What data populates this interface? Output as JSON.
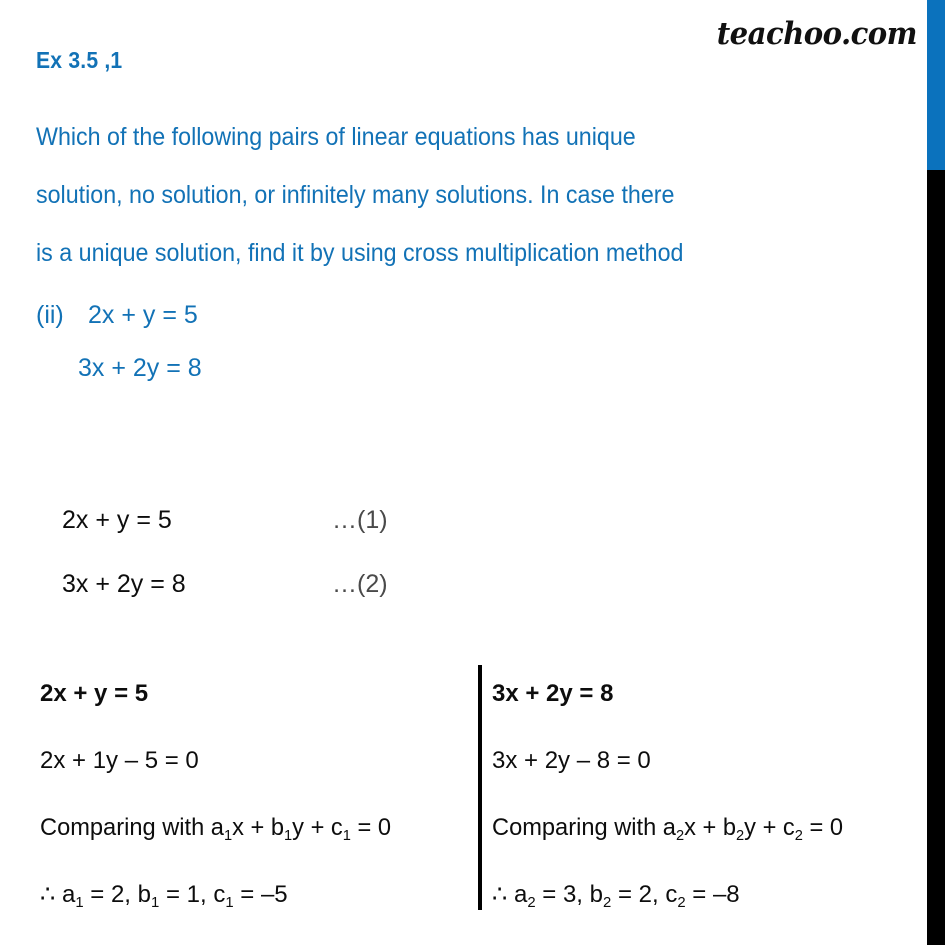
{
  "watermark": {
    "text": "teachoo.com"
  },
  "colors": {
    "accent_blue": "#1272b6",
    "strip_blue": "#0b72bd",
    "strip_black": "#000000",
    "body_black": "#0d0d0d",
    "tag_gray": "#4a4a4a"
  },
  "heading": {
    "text": "Ex 3.5 ,1"
  },
  "question": {
    "lines": [
      "Which of the following pairs of linear equations has unique",
      "solution, no solution, or infinitely many solutions. In case there",
      "is a unique solution, find it by using cross multiplication method"
    ],
    "part": {
      "label": "(ii)",
      "equation_1": "2x + y = 5",
      "equation_2": "3x + 2y = 8"
    }
  },
  "numbered_equations": [
    {
      "equation": "2x + y = 5",
      "tag": "…(1)"
    },
    {
      "equation": "3x + 2y = 8",
      "tag": "…(2)"
    }
  ],
  "compare_table": {
    "left_column": {
      "heading": "2x + y = 5",
      "standard_form": "2x + 1y – 5 = 0",
      "comparing_prefix": "Comparing with a",
      "comparing_sub_1": "1",
      "comparing_mid_1": "x + b",
      "comparing_sub_2": "1",
      "comparing_mid_2": "y + c",
      "comparing_sub_3": "1",
      "comparing_suffix": " = 0",
      "therefore_symbol": "∴",
      "coef_a_name": "a",
      "coef_a_sub": "1",
      "coef_a_value": " = 2, ",
      "coef_b_name": "b",
      "coef_b_sub": "1",
      "coef_b_value": " = 1, ",
      "coef_c_name": "c",
      "coef_c_sub": "1",
      "coef_c_value": " = –5"
    },
    "right_column": {
      "heading": "3x + 2y = 8",
      "standard_form": "3x + 2y – 8 = 0",
      "comparing_prefix": "Comparing with a",
      "comparing_sub_1": "2",
      "comparing_mid_1": "x + b",
      "comparing_sub_2": "2",
      "comparing_mid_2": "y + c",
      "comparing_sub_3": "2",
      "comparing_suffix": " = 0",
      "therefore_symbol": "∴",
      "coef_a_name": "a",
      "coef_a_sub": "2",
      "coef_a_value": " = 3, ",
      "coef_b_name": "b",
      "coef_b_sub": "2",
      "coef_b_value": " = 2, ",
      "coef_c_name": "c",
      "coef_c_sub": "2",
      "coef_c_value": " = –8"
    }
  }
}
